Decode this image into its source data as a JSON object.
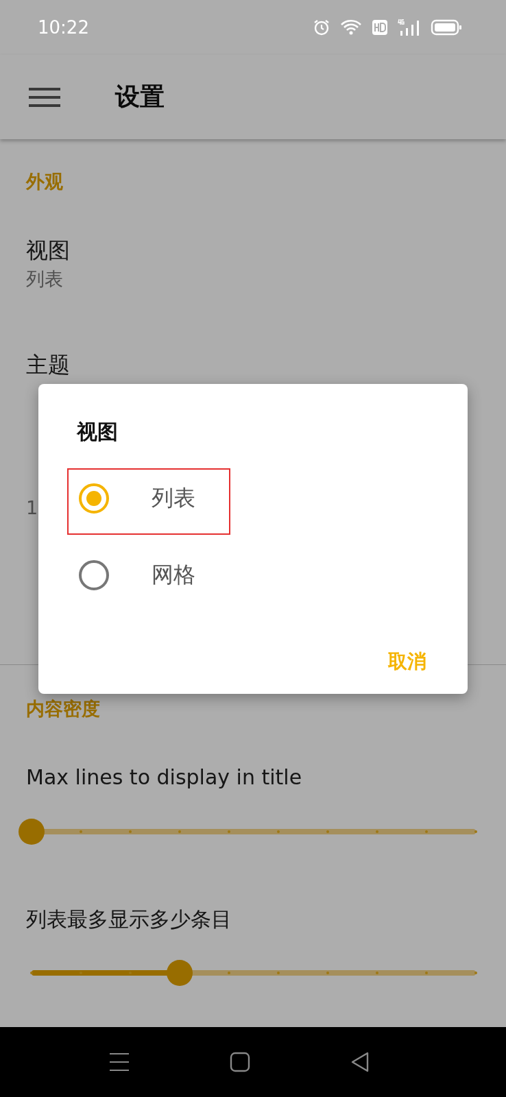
{
  "status_bar": {
    "time": "10:22"
  },
  "app_bar": {
    "title": "设置"
  },
  "sections": [
    {
      "header": "外观",
      "items": [
        {
          "title": "视图",
          "subtitle": "列表"
        },
        {
          "title": "主题"
        },
        {
          "subtitle": "1"
        }
      ]
    },
    {
      "header": "内容密度",
      "sliders": [
        {
          "label": "Max lines to display in title",
          "level": 0
        },
        {
          "label": "列表最多显示多少条目",
          "level": 0.333
        }
      ]
    }
  ],
  "dialog": {
    "title": "视图",
    "options": [
      {
        "label": "列表",
        "selected": true
      },
      {
        "label": "网格",
        "selected": false
      }
    ],
    "button": "取消"
  }
}
